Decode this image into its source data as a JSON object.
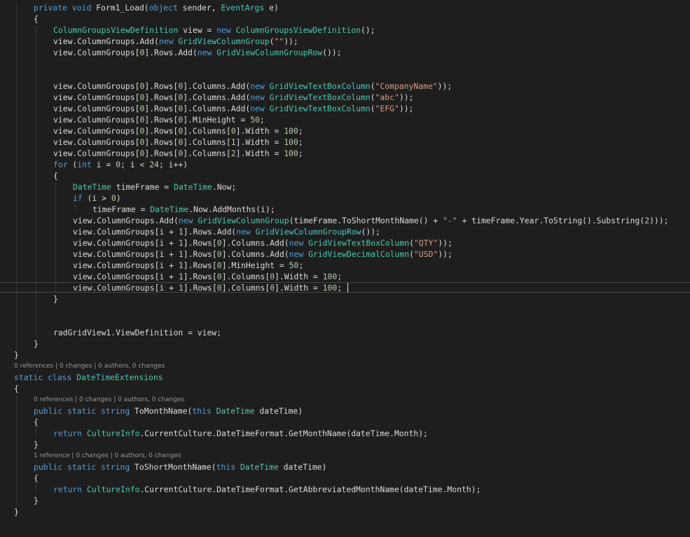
{
  "colors": {
    "background": "#1e1e1e",
    "keyword": "#569cd6",
    "type": "#4ec9b0",
    "string": "#d69d85",
    "number": "#b5cea8",
    "plain": "#dcdcdc",
    "codelens": "#999999"
  },
  "editor": {
    "lines": [
      {
        "indent": 1,
        "row": 0,
        "tokens": [
          [
            "k",
            "private"
          ],
          [
            "p",
            " "
          ],
          [
            "k",
            "void"
          ],
          [
            "p",
            " Form1_Load("
          ],
          [
            "k",
            "object"
          ],
          [
            "p",
            " sender, "
          ],
          [
            "t",
            "EventArgs"
          ],
          [
            "p",
            " e)"
          ]
        ]
      },
      {
        "indent": 1,
        "row": 1,
        "tokens": [
          [
            "p",
            "{"
          ]
        ]
      },
      {
        "indent": 2,
        "row": 2,
        "tokens": [
          [
            "t",
            "ColumnGroupsViewDefinition"
          ],
          [
            "p",
            " view = "
          ],
          [
            "k",
            "new"
          ],
          [
            "p",
            " "
          ],
          [
            "t",
            "ColumnGroupsViewDefinition"
          ],
          [
            "p",
            "();"
          ]
        ]
      },
      {
        "indent": 2,
        "row": 3,
        "tokens": [
          [
            "p",
            "view.ColumnGroups.Add("
          ],
          [
            "k",
            "new"
          ],
          [
            "p",
            " "
          ],
          [
            "t",
            "GridViewColumnGroup"
          ],
          [
            "p",
            "("
          ],
          [
            "s",
            "\"\""
          ],
          [
            "p",
            "));"
          ]
        ]
      },
      {
        "indent": 2,
        "row": 4,
        "tokens": [
          [
            "p",
            "view.ColumnGroups["
          ],
          [
            "n",
            "0"
          ],
          [
            "p",
            "].Rows.Add("
          ],
          [
            "k",
            "new"
          ],
          [
            "p",
            " "
          ],
          [
            "t",
            "GridViewColumnGroupRow"
          ],
          [
            "p",
            "());"
          ]
        ]
      },
      {
        "indent": 2,
        "row": 7,
        "tokens": [
          [
            "p",
            "view.ColumnGroups["
          ],
          [
            "n",
            "0"
          ],
          [
            "p",
            "].Rows["
          ],
          [
            "n",
            "0"
          ],
          [
            "p",
            "].Columns.Add("
          ],
          [
            "k",
            "new"
          ],
          [
            "p",
            " "
          ],
          [
            "t",
            "GridViewTextBoxColumn"
          ],
          [
            "p",
            "("
          ],
          [
            "s",
            "\"CompanyName\""
          ],
          [
            "p",
            "));"
          ]
        ]
      },
      {
        "indent": 2,
        "row": 8,
        "tokens": [
          [
            "p",
            "view.ColumnGroups["
          ],
          [
            "n",
            "0"
          ],
          [
            "p",
            "].Rows["
          ],
          [
            "n",
            "0"
          ],
          [
            "p",
            "].Columns.Add("
          ],
          [
            "k",
            "new"
          ],
          [
            "p",
            " "
          ],
          [
            "t",
            "GridViewTextBoxColumn"
          ],
          [
            "p",
            "("
          ],
          [
            "s",
            "\"abc\""
          ],
          [
            "p",
            "));"
          ]
        ]
      },
      {
        "indent": 2,
        "row": 9,
        "tokens": [
          [
            "p",
            "view.ColumnGroups["
          ],
          [
            "n",
            "0"
          ],
          [
            "p",
            "].Rows["
          ],
          [
            "n",
            "0"
          ],
          [
            "p",
            "].Columns.Add("
          ],
          [
            "k",
            "new"
          ],
          [
            "p",
            " "
          ],
          [
            "t",
            "GridViewTextBoxColumn"
          ],
          [
            "p",
            "("
          ],
          [
            "s",
            "\"EFG\""
          ],
          [
            "p",
            "));"
          ]
        ]
      },
      {
        "indent": 2,
        "row": 10,
        "tokens": [
          [
            "p",
            "view.ColumnGroups["
          ],
          [
            "n",
            "0"
          ],
          [
            "p",
            "].Rows["
          ],
          [
            "n",
            "0"
          ],
          [
            "p",
            "].MinHeight = "
          ],
          [
            "n",
            "50"
          ],
          [
            "p",
            ";"
          ]
        ]
      },
      {
        "indent": 2,
        "row": 11,
        "tokens": [
          [
            "p",
            "view.ColumnGroups["
          ],
          [
            "n",
            "0"
          ],
          [
            "p",
            "].Rows["
          ],
          [
            "n",
            "0"
          ],
          [
            "p",
            "].Columns["
          ],
          [
            "n",
            "0"
          ],
          [
            "p",
            "].Width = "
          ],
          [
            "n",
            "100"
          ],
          [
            "p",
            ";"
          ]
        ]
      },
      {
        "indent": 2,
        "row": 12,
        "tokens": [
          [
            "p",
            "view.ColumnGroups["
          ],
          [
            "n",
            "0"
          ],
          [
            "p",
            "].Rows["
          ],
          [
            "n",
            "0"
          ],
          [
            "p",
            "].Columns["
          ],
          [
            "n",
            "1"
          ],
          [
            "p",
            "].Width = "
          ],
          [
            "n",
            "100"
          ],
          [
            "p",
            ";"
          ]
        ]
      },
      {
        "indent": 2,
        "row": 13,
        "tokens": [
          [
            "p",
            "view.ColumnGroups["
          ],
          [
            "n",
            "0"
          ],
          [
            "p",
            "].Rows["
          ],
          [
            "n",
            "0"
          ],
          [
            "p",
            "].Columns["
          ],
          [
            "n",
            "2"
          ],
          [
            "p",
            "].Width = "
          ],
          [
            "n",
            "100"
          ],
          [
            "p",
            ";"
          ]
        ]
      },
      {
        "indent": 2,
        "row": 14,
        "tokens": [
          [
            "k",
            "for"
          ],
          [
            "p",
            " ("
          ],
          [
            "k",
            "int"
          ],
          [
            "p",
            " i = "
          ],
          [
            "n",
            "0"
          ],
          [
            "p",
            "; i < "
          ],
          [
            "n",
            "24"
          ],
          [
            "p",
            "; i++)"
          ]
        ]
      },
      {
        "indent": 2,
        "row": 15,
        "tokens": [
          [
            "p",
            "{"
          ]
        ]
      },
      {
        "indent": 3,
        "row": 16,
        "tokens": [
          [
            "t",
            "DateTime"
          ],
          [
            "p",
            " timeFrame = "
          ],
          [
            "t",
            "DateTime"
          ],
          [
            "p",
            ".Now;"
          ]
        ]
      },
      {
        "indent": 3,
        "row": 17,
        "tokens": [
          [
            "k",
            "if"
          ],
          [
            "p",
            " (i > "
          ],
          [
            "n",
            "0"
          ],
          [
            "p",
            ")"
          ]
        ]
      },
      {
        "indent": 4,
        "row": 18,
        "tokens": [
          [
            "p",
            "timeFrame = "
          ],
          [
            "t",
            "DateTime"
          ],
          [
            "p",
            ".Now.AddMonths(i);"
          ]
        ]
      },
      {
        "indent": 3,
        "row": 19,
        "tokens": [
          [
            "p",
            "view.ColumnGroups.Add("
          ],
          [
            "k",
            "new"
          ],
          [
            "p",
            " "
          ],
          [
            "t",
            "GridViewColumnGroup"
          ],
          [
            "p",
            "(timeFrame.ToShortMonthName() + "
          ],
          [
            "s",
            "\"-\""
          ],
          [
            "p",
            " + timeFrame.Year.ToString().Substring("
          ],
          [
            "n",
            "2"
          ],
          [
            "p",
            ")));"
          ]
        ]
      },
      {
        "indent": 3,
        "row": 20,
        "tokens": [
          [
            "p",
            "view.ColumnGroups[i + "
          ],
          [
            "n",
            "1"
          ],
          [
            "p",
            "].Rows.Add("
          ],
          [
            "k",
            "new"
          ],
          [
            "p",
            " "
          ],
          [
            "t",
            "GridViewColumnGroupRow"
          ],
          [
            "p",
            "());"
          ]
        ]
      },
      {
        "indent": 3,
        "row": 21,
        "tokens": [
          [
            "p",
            "view.ColumnGroups[i + "
          ],
          [
            "n",
            "1"
          ],
          [
            "p",
            "].Rows["
          ],
          [
            "n",
            "0"
          ],
          [
            "p",
            "].Columns.Add("
          ],
          [
            "k",
            "new"
          ],
          [
            "p",
            " "
          ],
          [
            "t",
            "GridViewTextBoxColumn"
          ],
          [
            "p",
            "("
          ],
          [
            "s",
            "\"QTY\""
          ],
          [
            "p",
            "));"
          ]
        ]
      },
      {
        "indent": 3,
        "row": 22,
        "tokens": [
          [
            "p",
            "view.ColumnGroups[i + "
          ],
          [
            "n",
            "1"
          ],
          [
            "p",
            "].Rows["
          ],
          [
            "n",
            "0"
          ],
          [
            "p",
            "].Columns.Add("
          ],
          [
            "k",
            "new"
          ],
          [
            "p",
            " "
          ],
          [
            "t",
            "GridViewDecimalColumn"
          ],
          [
            "p",
            "("
          ],
          [
            "s",
            "\"USD\""
          ],
          [
            "p",
            "));"
          ]
        ]
      },
      {
        "indent": 3,
        "row": 23,
        "tokens": [
          [
            "p",
            "view.ColumnGroups[i + "
          ],
          [
            "n",
            "1"
          ],
          [
            "p",
            "].Rows["
          ],
          [
            "n",
            "0"
          ],
          [
            "p",
            "].MinHeight = "
          ],
          [
            "n",
            "50"
          ],
          [
            "p",
            ";"
          ]
        ]
      },
      {
        "indent": 3,
        "row": 24,
        "tokens": [
          [
            "p",
            "view.ColumnGroups[i + "
          ],
          [
            "n",
            "1"
          ],
          [
            "p",
            "].Rows["
          ],
          [
            "n",
            "0"
          ],
          [
            "p",
            "].Columns["
          ],
          [
            "n",
            "0"
          ],
          [
            "p",
            "].Width = "
          ],
          [
            "n",
            "100"
          ],
          [
            "p",
            ";"
          ]
        ]
      },
      {
        "indent": 3,
        "row": 25,
        "tokens": [
          [
            "p",
            "view.ColumnGroups[i + "
          ],
          [
            "n",
            "1"
          ],
          [
            "p",
            "].Rows["
          ],
          [
            "n",
            "0"
          ],
          [
            "p",
            "].Columns["
          ],
          [
            "n",
            "0"
          ],
          [
            "p",
            "].Width = "
          ],
          [
            "n",
            "100"
          ],
          [
            "p",
            ";"
          ]
        ]
      },
      {
        "indent": 2,
        "row": 26,
        "tokens": [
          [
            "p",
            "}"
          ]
        ]
      },
      {
        "indent": 2,
        "row": 29,
        "tokens": [
          [
            "p",
            "radGridView1.ViewDefinition = view;"
          ]
        ]
      },
      {
        "indent": 1,
        "row": 30,
        "tokens": [
          [
            "p",
            "}"
          ]
        ]
      },
      {
        "indent": 0,
        "row": 31,
        "tokens": [
          [
            "p",
            "}"
          ]
        ]
      },
      {
        "indent": 0,
        "row": 33,
        "tokens": [
          [
            "k",
            "static"
          ],
          [
            "p",
            " "
          ],
          [
            "k",
            "class"
          ],
          [
            "p",
            " "
          ],
          [
            "t",
            "DateTimeExtensions"
          ]
        ]
      },
      {
        "indent": 0,
        "row": 34,
        "tokens": [
          [
            "p",
            "{"
          ]
        ]
      },
      {
        "indent": 1,
        "row": 36,
        "tokens": [
          [
            "k",
            "public"
          ],
          [
            "p",
            " "
          ],
          [
            "k",
            "static"
          ],
          [
            "p",
            " "
          ],
          [
            "k",
            "string"
          ],
          [
            "p",
            " ToMonthName("
          ],
          [
            "k",
            "this"
          ],
          [
            "p",
            " "
          ],
          [
            "t",
            "DateTime"
          ],
          [
            "p",
            " dateTime)"
          ]
        ]
      },
      {
        "indent": 1,
        "row": 37,
        "tokens": [
          [
            "p",
            "{"
          ]
        ]
      },
      {
        "indent": 2,
        "row": 38,
        "tokens": [
          [
            "k",
            "return"
          ],
          [
            "p",
            " "
          ],
          [
            "t",
            "CultureInfo"
          ],
          [
            "p",
            ".CurrentCulture.DateTimeFormat.GetMonthName(dateTime.Month);"
          ]
        ]
      },
      {
        "indent": 1,
        "row": 39,
        "tokens": [
          [
            "p",
            "}"
          ]
        ]
      },
      {
        "indent": 1,
        "row": 41,
        "tokens": [
          [
            "k",
            "public"
          ],
          [
            "p",
            " "
          ],
          [
            "k",
            "static"
          ],
          [
            "p",
            " "
          ],
          [
            "k",
            "string"
          ],
          [
            "p",
            " ToShortMonthName("
          ],
          [
            "k",
            "this"
          ],
          [
            "p",
            " "
          ],
          [
            "t",
            "DateTime"
          ],
          [
            "p",
            " dateTime)"
          ]
        ]
      },
      {
        "indent": 1,
        "row": 42,
        "tokens": [
          [
            "p",
            "{"
          ]
        ]
      },
      {
        "indent": 2,
        "row": 43,
        "tokens": [
          [
            "k",
            "return"
          ],
          [
            "p",
            " "
          ],
          [
            "t",
            "CultureInfo"
          ],
          [
            "p",
            ".CurrentCulture.DateTimeFormat.GetAbbreviatedMonthName(dateTime.Month);"
          ]
        ]
      },
      {
        "indent": 1,
        "row": 44,
        "tokens": [
          [
            "p",
            "}"
          ]
        ]
      },
      {
        "indent": 0,
        "row": 45,
        "tokens": [
          [
            "p",
            "}"
          ]
        ]
      }
    ],
    "codelens": [
      {
        "text": "0 references | 0 changes | 0 authors, 0 changes",
        "indent": 0,
        "row": 32
      },
      {
        "text": "0 references | 0 changes | 0 authors, 0 changes",
        "indent": 1,
        "row": 35
      },
      {
        "text": "1 reference | 0 changes | 0 authors, 0 changes",
        "indent": 1,
        "row": 40
      }
    ],
    "guides": [
      {
        "level": 1,
        "from": 2,
        "to": 29
      },
      {
        "level": 2,
        "from": 16,
        "to": 25
      },
      {
        "level": 3,
        "from": 18,
        "to": 18
      },
      {
        "level": 0,
        "from": 0,
        "to": 30
      },
      {
        "level": 0,
        "from": 35,
        "to": 44
      },
      {
        "level": 1,
        "from": 38,
        "to": 38
      },
      {
        "level": 1,
        "from": 43,
        "to": 43
      }
    ]
  }
}
